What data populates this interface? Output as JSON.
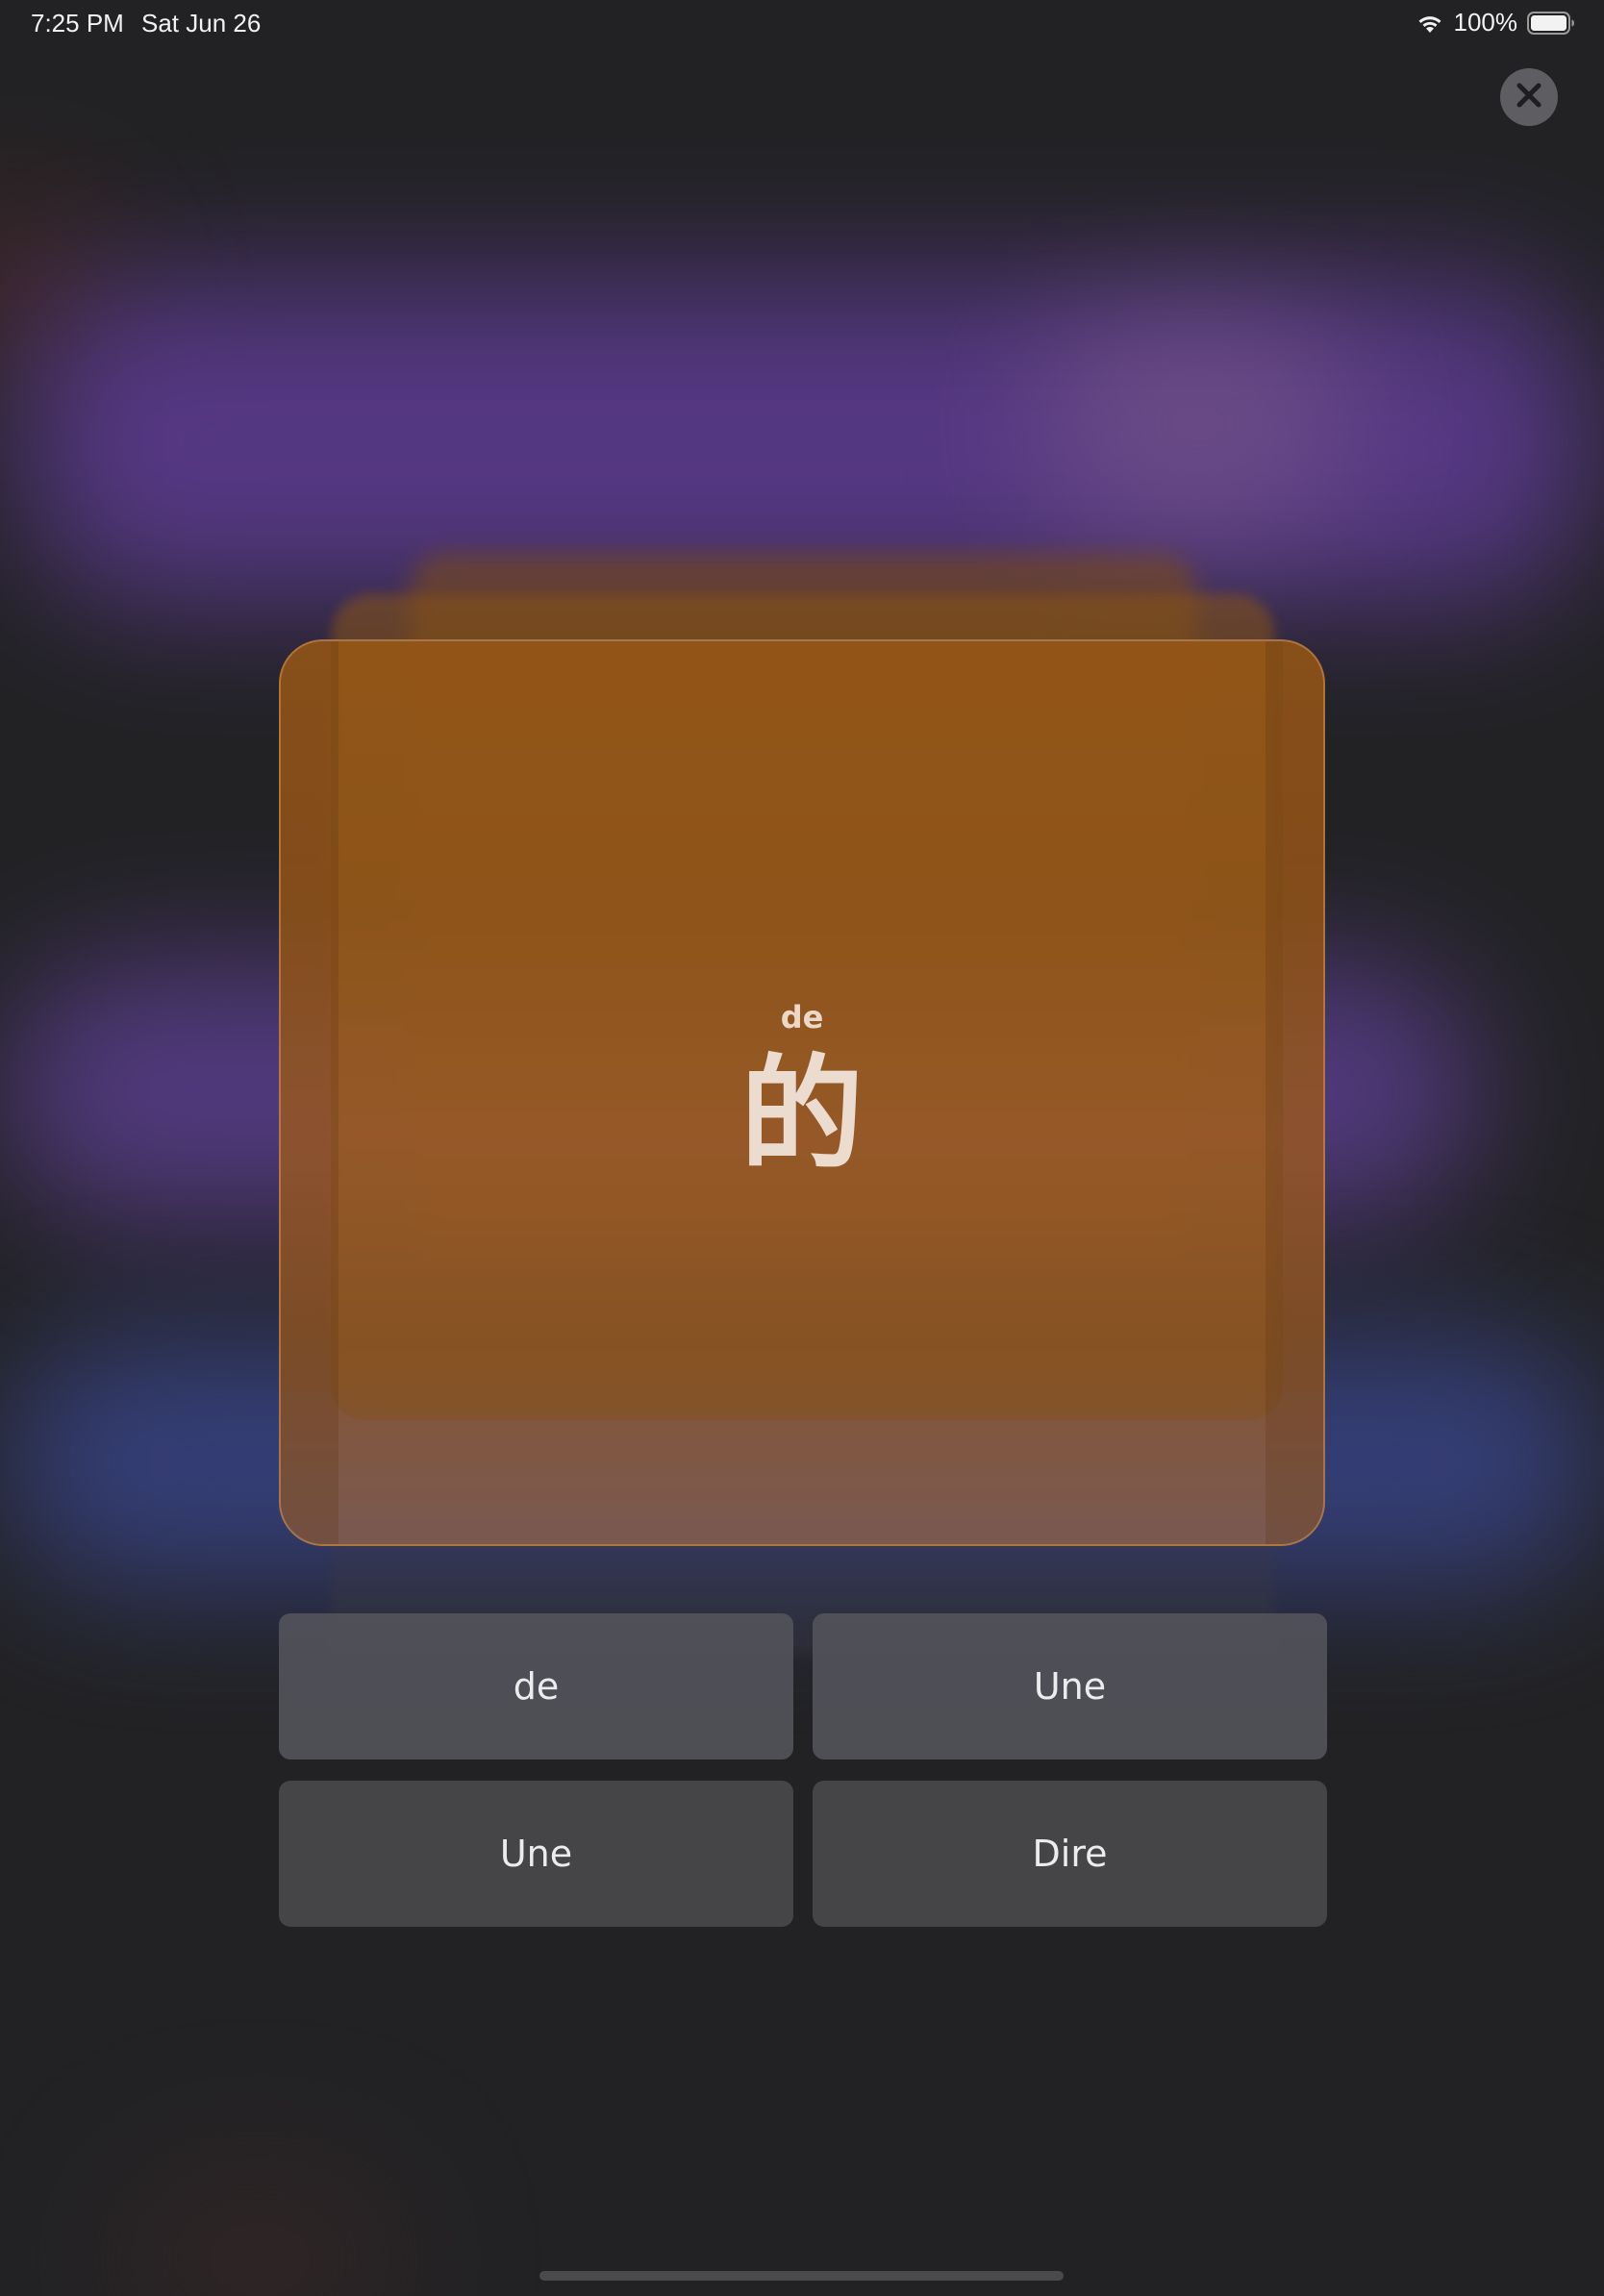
{
  "status_bar": {
    "time": "7:25 PM",
    "date": "Sat Jun 26",
    "battery_percent": "100%",
    "battery_level": 1.0,
    "icons": [
      "wifi-icon",
      "battery-icon"
    ]
  },
  "close_button": {
    "icon": "close-icon"
  },
  "card": {
    "pinyin": "de",
    "character": "的",
    "color": "#9a5a1e"
  },
  "answers": [
    {
      "label": "de"
    },
    {
      "label": "Une"
    },
    {
      "label": "Une"
    },
    {
      "label": "Dire"
    }
  ]
}
